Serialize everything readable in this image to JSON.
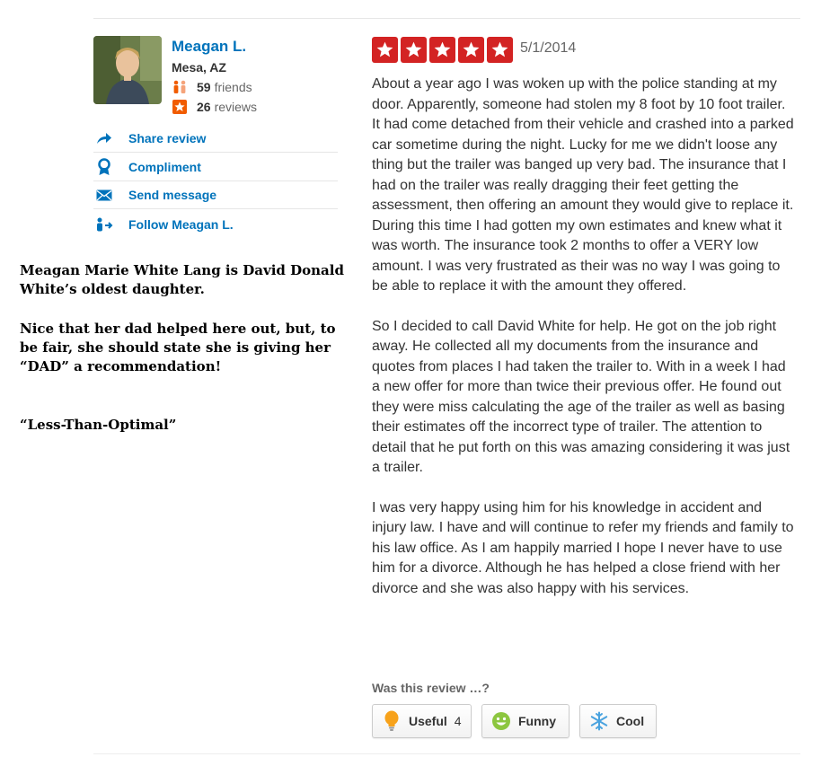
{
  "user": {
    "name": "Meagan L.",
    "location": "Mesa, AZ",
    "friends_count": "59",
    "friends_label": "friends",
    "reviews_count": "26",
    "reviews_label": "reviews"
  },
  "actions": [
    {
      "label": "Share review",
      "icon": "share-arrow-icon"
    },
    {
      "label": "Compliment",
      "icon": "ribbon-icon"
    },
    {
      "label": "Send message",
      "icon": "envelope-icon"
    },
    {
      "label": "Follow Meagan L.",
      "icon": "follow-user-icon"
    }
  ],
  "annotation": {
    "para1": "Meagan Marie White Lang is David Donald White’s oldest daughter.",
    "para2": "Nice that her dad helped here out, but, to be fair, she should state she is giving her “DAD” a recommendation!",
    "para3": "“Less-Than-Optimal”"
  },
  "review": {
    "rating": 5,
    "max_rating": 5,
    "date": "5/1/2014",
    "paragraphs": [
      "About a year ago I was woken up with the police standing at my door.  Apparently, someone had stolen my 8 foot by 10 foot trailer.  It had come detached from their vehicle and crashed into a parked car sometime during the night.  Lucky for me we didn't loose any thing but the trailer was banged up very bad.  The insurance that I had on the trailer was really dragging their feet getting the assessment, then offering an amount they would give to replace it.  During this time I had gotten my own estimates and knew what it was worth.  The insurance took 2 months to offer a VERY low amount.  I was very frustrated as their was no way I was going to be able to replace it with the amount they offered.",
      "So I decided to call David White for help.  He got on the job right away.  He collected all my documents from the insurance and quotes from places I had taken the trailer to.  With in a week I had a new offer for more than twice their previous offer.  He found out they were miss calculating the age of the trailer as well as basing their estimates off the incorrect type of trailer.  The attention to detail that he put forth on this was amazing considering it was just a trailer.",
      "I was very happy using him for his knowledge in accident and injury law.  I have and will continue to refer my friends and family to his law office.  As I am happily married I hope I never have to use him for a divorce.  Although he has helped a close friend with her divorce and she was also happy with his services."
    ]
  },
  "feedback": {
    "prompt": "Was this review …?",
    "useful_label": "Useful",
    "useful_count": "4",
    "funny_label": "Funny",
    "cool_label": "Cool"
  },
  "colors": {
    "star_red": "#d32323",
    "link_blue": "#0073bb",
    "friends_orange": "#f15c00"
  }
}
